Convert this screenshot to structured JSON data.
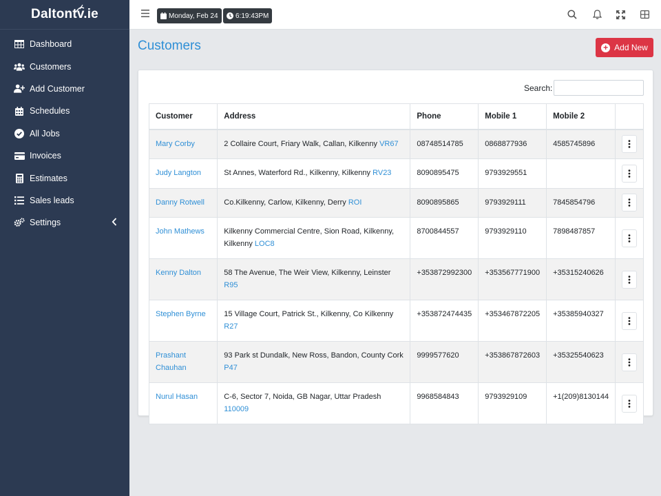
{
  "brand": {
    "name": "Daltontv.ie"
  },
  "sidebar": {
    "items": [
      {
        "label": "Dashboard",
        "icon": "table-icon"
      },
      {
        "label": "Customers",
        "icon": "users-icon"
      },
      {
        "label": "Add Customer",
        "icon": "user-plus-icon"
      },
      {
        "label": "Schedules",
        "icon": "calendar-icon"
      },
      {
        "label": "All Jobs",
        "icon": "check-circle-icon"
      },
      {
        "label": "Invoices",
        "icon": "credit-card-icon"
      },
      {
        "label": "Estimates",
        "icon": "calculator-icon"
      },
      {
        "label": "Sales leads",
        "icon": "list-icon"
      },
      {
        "label": "Settings",
        "icon": "cogs-icon"
      }
    ]
  },
  "topbar": {
    "date": "Monday, Feb 24",
    "time": "6:19:43PM",
    "icons": [
      "search-icon",
      "bell-icon",
      "expand-icon",
      "grid-icon"
    ]
  },
  "page": {
    "title": "Customers",
    "add_button": "Add New",
    "search_label": "Search:",
    "search_value": ""
  },
  "table": {
    "headers": [
      "Customer",
      "Address",
      "Phone",
      "Mobile 1",
      "Mobile 2",
      ""
    ],
    "rows": [
      {
        "name": "Mary Corby",
        "address": "2 Collaire Court, Friary Walk, Callan, Kilkenny",
        "code": "VR67",
        "phone": "08748514785",
        "mobile1": "0868877936",
        "mobile2": "4585745896"
      },
      {
        "name": "Judy Langton",
        "address": "St Annes, Waterford Rd., Kilkenny, Kilkenny",
        "code": "RV23",
        "phone": "8090895475",
        "mobile1": "9793929551",
        "mobile2": ""
      },
      {
        "name": "Danny Rotwell",
        "address": "Co.Kilkenny, Carlow, Kilkenny, Derry",
        "code": "ROI",
        "phone": "8090895865",
        "mobile1": "9793929111",
        "mobile2": "7845854796"
      },
      {
        "name": "John Mathews",
        "address": "Kilkenny Commercial Centre, Sion Road, Kilkenny, Kilkenny",
        "code": "LOC8",
        "phone": "8700844557",
        "mobile1": "9793929110",
        "mobile2": "7898487857"
      },
      {
        "name": "Kenny Dalton",
        "address": "58 The Avenue, The Weir View, Kilkenny, Leinster",
        "code": "R95",
        "phone": "+353872992300",
        "mobile1": "+353567771900",
        "mobile2": "+35315240626"
      },
      {
        "name": "Stephen Byrne",
        "address": "15 Village Court, Patrick St., Kilkenny, Co Kilkenny",
        "code": "R27",
        "phone": "+353872474435",
        "mobile1": "+353467872205",
        "mobile2": "+35385940327"
      },
      {
        "name": "Prashant Chauhan",
        "address": "93 Park st Dundalk, New Ross, Bandon, County Cork",
        "code": "P47",
        "phone": "9999577620",
        "mobile1": "+353867872603",
        "mobile2": "+35325540623"
      },
      {
        "name": "Nurul Hasan",
        "address": "C-6, Sector 7, Noida, GB Nagar, Uttar Pradesh",
        "code": "110009",
        "phone": "9968584843",
        "mobile1": "9793929109",
        "mobile2": "+1(209)8130144"
      }
    ]
  },
  "colors": {
    "sidebar": "#2c3a52",
    "accent": "#2f8fd6",
    "danger": "#dc3545"
  }
}
